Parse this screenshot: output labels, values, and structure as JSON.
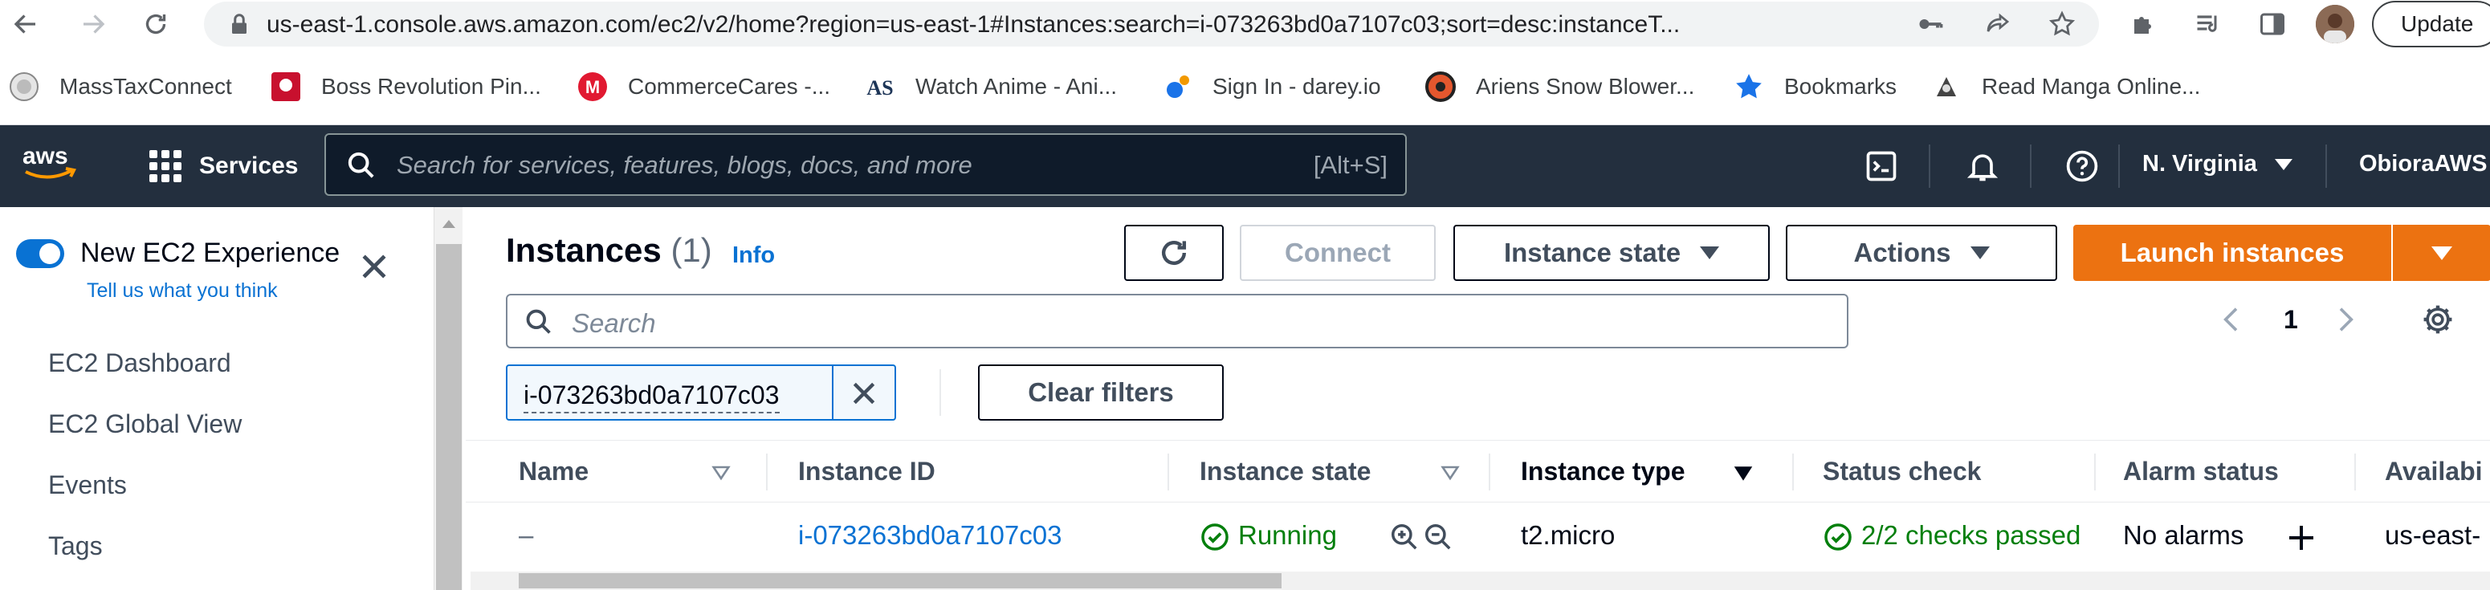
{
  "browser": {
    "url": "us-east-1.console.aws.amazon.com/ec2/v2/home?region=us-east-1#Instances:search=i-073263bd0a7107c03;sort=desc:instanceT...",
    "update_label": "Update",
    "bookmarks": [
      {
        "label": "MassTaxConnect",
        "icon": "seal-icon"
      },
      {
        "label": "Boss Revolution Pin...",
        "icon": "boss-revolution-icon"
      },
      {
        "label": "CommerceCares -...",
        "icon": "commercecares-icon"
      },
      {
        "label": "Watch Anime - Ani...",
        "icon": "anime-icon"
      },
      {
        "label": "Sign In - darey.io",
        "icon": "darey-icon"
      },
      {
        "label": "Ariens Snow Blower...",
        "icon": "ariens-icon"
      },
      {
        "label": "Bookmarks",
        "icon": "star-icon"
      },
      {
        "label": "Read Manga Online...",
        "icon": "manga-icon"
      }
    ]
  },
  "aws_nav": {
    "services_label": "Services",
    "search_placeholder": "Search for services, features, blogs, docs, and more",
    "search_shortcut": "[Alt+S]",
    "region": "N. Virginia",
    "account": "ObioraAWS"
  },
  "sidebar": {
    "new_experience_label": "New EC2 Experience",
    "tell_us_label": "Tell us what you think",
    "items": [
      "EC2 Dashboard",
      "EC2 Global View",
      "Events",
      "Tags"
    ]
  },
  "main": {
    "title": "Instances",
    "count": "(1)",
    "info_label": "Info",
    "connect_label": "Connect",
    "instance_state_label": "Instance state",
    "actions_label": "Actions",
    "launch_label": "Launch instances",
    "search_placeholder": "Search",
    "page_number": "1",
    "filter_token": "i-073263bd0a7107c03",
    "clear_filters_label": "Clear filters",
    "columns": [
      "Name",
      "Instance ID",
      "Instance state",
      "Instance type",
      "Status check",
      "Alarm status",
      "Availabi"
    ],
    "row": {
      "name": "–",
      "instance_id": "i-073263bd0a7107c03",
      "state": "Running",
      "type": "t2.micro",
      "status_check": "2/2 checks passed",
      "alarm_status": "No alarms",
      "availability": "us-east-"
    }
  },
  "colors": {
    "aws_nav_bg": "#232f3e",
    "primary_orange": "#ec7211",
    "link_blue": "#0972d3",
    "success_green": "#037f0c"
  }
}
